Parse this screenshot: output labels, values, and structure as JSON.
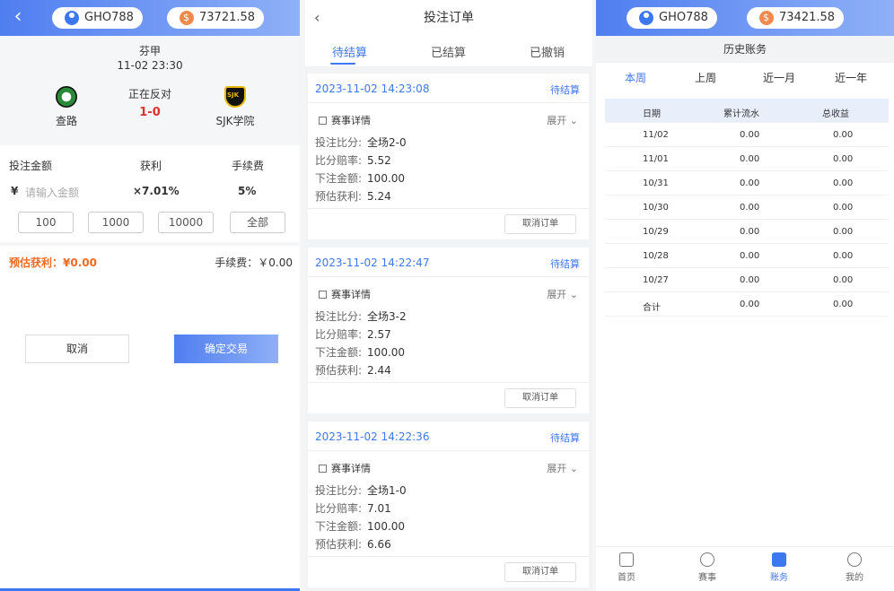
{
  "user_pill": {
    "name": "GHO788"
  },
  "left": {
    "balance": "73721.58",
    "league": "芬甲",
    "match_time": "11-02 23:30",
    "status": "正在反对",
    "score": "1-0",
    "home_team": "查路",
    "away_team": "SJK学院",
    "col_amount": "投注金额",
    "col_profit": "获利",
    "col_fee": "手续费",
    "currency": "¥",
    "amount_placeholder": "请输入金额",
    "profit_rate": "×7.01%",
    "fee_rate": "5%",
    "quick": [
      "100",
      "1000",
      "10000",
      "全部"
    ],
    "est_label": "预估获利：¥0.00",
    "fee_label": "手续费：￥0.00",
    "cancel": "取消",
    "confirm": "确定交易"
  },
  "orders": {
    "title": "投注订单",
    "tabs": [
      "待结算",
      "已结算",
      "已撤销"
    ],
    "detail_label": "赛事详情",
    "expand_label": "展开",
    "cancel_label": "取消订单",
    "labels": {
      "score": "投注比分:",
      "odds": "比分赔率:",
      "amount": "下注金额:",
      "profit": "预估获利:"
    },
    "items": [
      {
        "time": "2023-11-02 14:23:08",
        "status": "待结算",
        "score": "全场2-0",
        "odds": "5.52",
        "amount": "100.00",
        "profit": "5.24"
      },
      {
        "time": "2023-11-02 14:22:47",
        "status": "待结算",
        "score": "全场3-2",
        "odds": "2.57",
        "amount": "100.00",
        "profit": "2.44"
      },
      {
        "time": "2023-11-02 14:22:36",
        "status": "待结算",
        "score": "全场1-0",
        "odds": "7.01",
        "amount": "100.00",
        "profit": "6.66"
      }
    ]
  },
  "history": {
    "balance": "73421.58",
    "title": "历史账务",
    "tabs": [
      "本周",
      "上周",
      "近一月",
      "近一年"
    ],
    "headers": [
      "日期",
      "累计流水",
      "总收益"
    ],
    "rows": [
      [
        "11/02",
        "0.00",
        "0.00"
      ],
      [
        "11/01",
        "0.00",
        "0.00"
      ],
      [
        "10/31",
        "0.00",
        "0.00"
      ],
      [
        "10/30",
        "0.00",
        "0.00"
      ],
      [
        "10/29",
        "0.00",
        "0.00"
      ],
      [
        "10/28",
        "0.00",
        "0.00"
      ],
      [
        "10/27",
        "0.00",
        "0.00"
      ],
      [
        "合计",
        "0.00",
        "0.00"
      ]
    ],
    "nav": [
      "首页",
      "赛事",
      "账务",
      "我的"
    ]
  },
  "colors": {
    "accent": "#3e78f0",
    "orange": "#f06a21",
    "red": "#e03030"
  }
}
